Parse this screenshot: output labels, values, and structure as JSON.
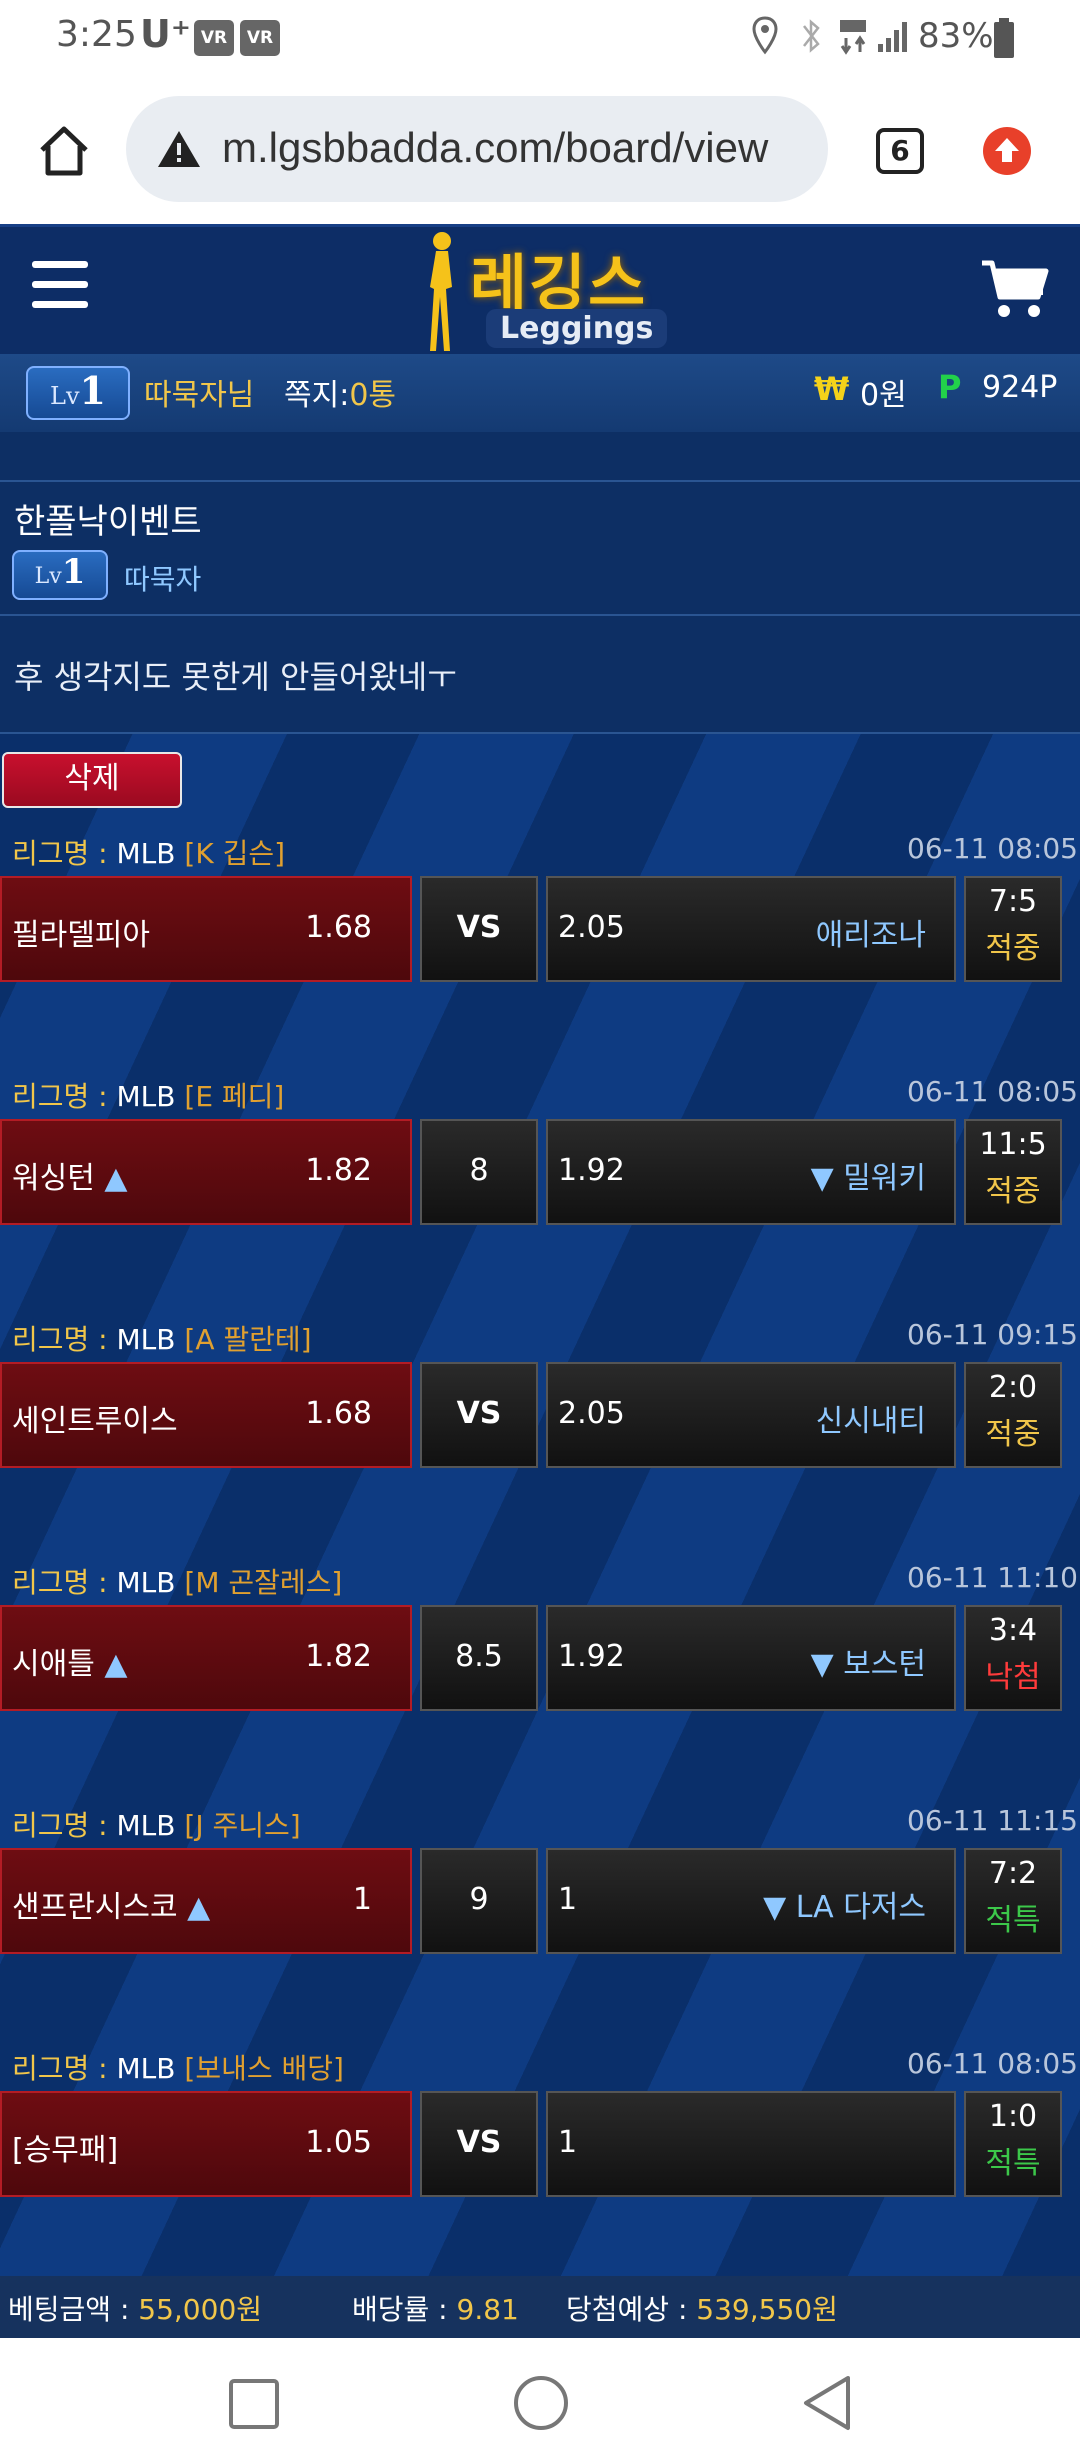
{
  "status_bar": {
    "time": "3:25",
    "carrier": "U⁺",
    "vr_badges": [
      "VR",
      "VR"
    ],
    "battery": "83%"
  },
  "browser": {
    "url": "m.lgsbbadda.com/board/view",
    "tab_count": "6"
  },
  "site": {
    "logo_korean": "레깅스",
    "logo_english": "Leggings"
  },
  "user": {
    "level_prefix": "Lv",
    "level_num": "1",
    "name": "따묵자님",
    "note_label": "쪽지:",
    "note_count": "0통",
    "won_symbol": "₩",
    "cash": "0원",
    "points_symbol": "P",
    "points": "924P"
  },
  "post": {
    "title": "한폴낙이벤트",
    "author": "따묵자",
    "author_level": "1",
    "content": "후 생각지도 못한게 안들어왔네ㅜ",
    "delete_label": "삭제"
  },
  "bets": [
    {
      "league_label": "리그명",
      "league": "MLB",
      "pitcher": "[K 깁슨]",
      "time": "06-11 08:05",
      "home": "필라델피아",
      "home_arrow": "",
      "home_odd": "1.68",
      "mid": "VS",
      "mid_vs": true,
      "away_odd": "2.05",
      "away_arrow": "",
      "away": "애리조나",
      "score": "7:5",
      "status": "적중",
      "status_type": "hit"
    },
    {
      "league_label": "리그명",
      "league": "MLB",
      "pitcher": "[E 페디]",
      "time": "06-11 08:05",
      "home": "워싱턴",
      "home_arrow": "▲",
      "home_odd": "1.82",
      "mid": "8",
      "mid_vs": false,
      "away_odd": "1.92",
      "away_arrow": "▼",
      "away": "밀워키",
      "score": "11:5",
      "status": "적중",
      "status_type": "hit"
    },
    {
      "league_label": "리그명",
      "league": "MLB",
      "pitcher": "[A 팔란테]",
      "time": "06-11 09:15",
      "home": "세인트루이스",
      "home_arrow": "",
      "home_odd": "1.68",
      "mid": "VS",
      "mid_vs": true,
      "away_odd": "2.05",
      "away_arrow": "",
      "away": "신시내티",
      "score": "2:0",
      "status": "적중",
      "status_type": "hit"
    },
    {
      "league_label": "리그명",
      "league": "MLB",
      "pitcher": "[M 곤잘레스]",
      "time": "06-11 11:10",
      "home": "시애틀",
      "home_arrow": "▲",
      "home_odd": "1.82",
      "mid": "8.5",
      "mid_vs": false,
      "away_odd": "1.92",
      "away_arrow": "▼",
      "away": "보스턴",
      "score": "3:4",
      "status": "낙첨",
      "status_type": "miss"
    },
    {
      "league_label": "리그명",
      "league": "MLB",
      "pitcher": "[J 주니스]",
      "time": "06-11 11:15",
      "home": "샌프란시스코",
      "home_arrow": "▲",
      "home_odd": "1",
      "mid": "9",
      "mid_vs": false,
      "away_odd": "1",
      "away_arrow": "▼",
      "away": "LA 다저스",
      "score": "7:2",
      "status": "적특",
      "status_type": "special"
    },
    {
      "league_label": "리그명",
      "league": "MLB",
      "pitcher": "[보내스 배당]",
      "time": "06-11 08:05",
      "home": "[승무패]",
      "home_arrow": "",
      "home_odd": "1.05",
      "mid": "VS",
      "mid_vs": true,
      "away_odd": "1",
      "away_arrow": "",
      "away": "",
      "score": "1:0",
      "status": "적특",
      "status_type": "special"
    }
  ],
  "summary": {
    "bet_amount_label": "베팅금액 : ",
    "bet_amount": "55,000원",
    "odds_label": "배당률 : ",
    "odds": "9.81",
    "expected_label": "당첨예상 : ",
    "expected": "539,550원"
  },
  "colors": {
    "gold": "#f1c64a",
    "hit": "#f1c64a",
    "miss": "#ff3b3b",
    "special": "#3cc84a",
    "header_blue": "#0d2d66"
  }
}
